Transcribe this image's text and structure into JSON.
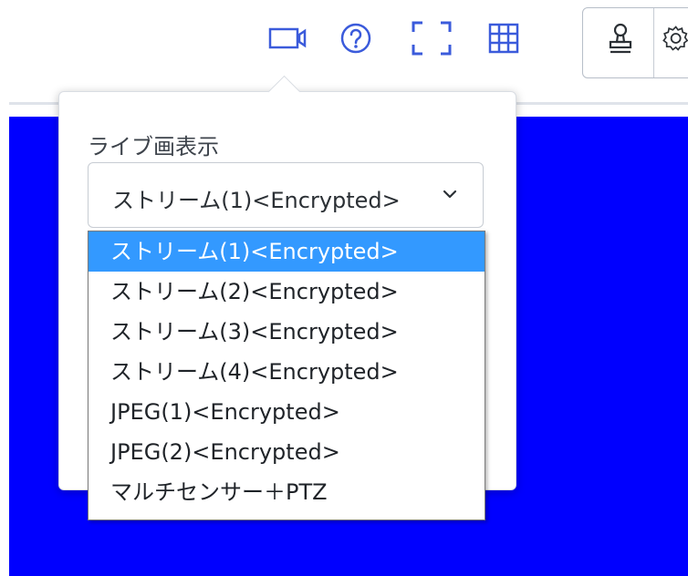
{
  "toolbar": {
    "icons": [
      "video-camera-icon",
      "help-circle-icon",
      "fullscreen-icon",
      "grid-icon",
      "stamp-icon",
      "settings-icon"
    ]
  },
  "popover": {
    "label": "ライブ画表示",
    "select": {
      "value": "ストリーム(1)<Encrypted>"
    },
    "options": [
      "ストリーム(1)<Encrypted>",
      "ストリーム(2)<Encrypted>",
      "ストリーム(3)<Encrypted>",
      "ストリーム(4)<Encrypted>",
      "JPEG(1)<Encrypted>",
      "JPEG(2)<Encrypted>",
      "マルチセンサー＋PTZ"
    ],
    "selected_index": 0
  },
  "colors": {
    "accent": "#3b5bdb",
    "selected_option": "#3399ff",
    "video_background": "#0000ff"
  }
}
